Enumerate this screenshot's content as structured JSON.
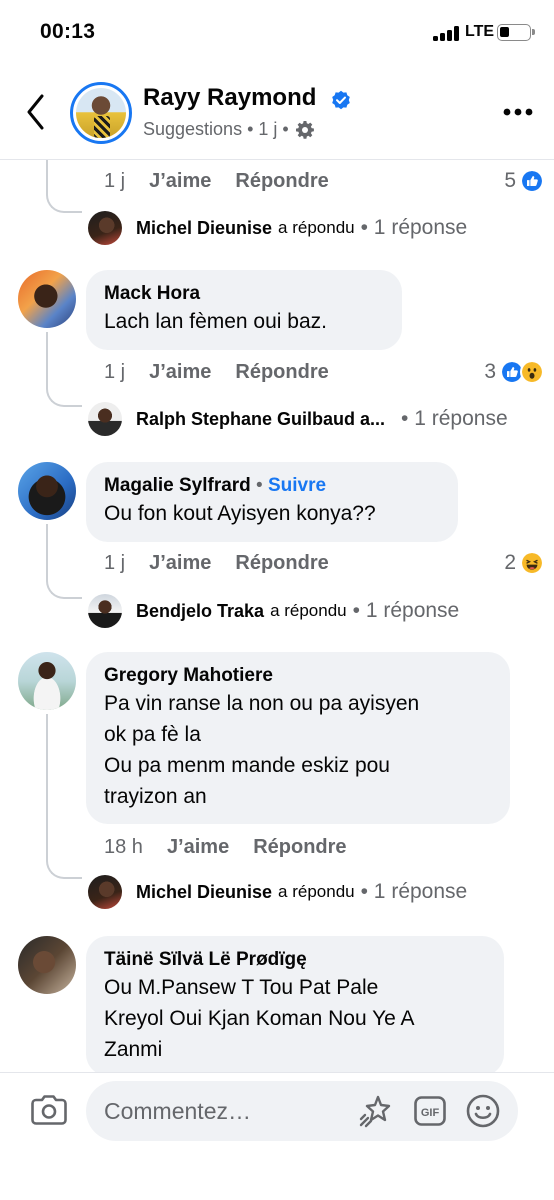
{
  "status_bar": {
    "time": "00:13",
    "network": "LTE"
  },
  "header": {
    "name": "Rayy Raymond",
    "subtitle": "Suggestions • 1 j •",
    "accent_color": "#1877f2"
  },
  "comments": [
    {
      "id": "top-fragment",
      "time": "1 j",
      "like": "J’aime",
      "reply": "Répondre",
      "reaction_count": "5",
      "reactions": [
        "like"
      ],
      "reply_preview": {
        "name": "Michel Dieunise",
        "text": "a répondu",
        "count": "• 1 réponse"
      }
    },
    {
      "id": "mack",
      "author": "Mack Hora",
      "follow": "",
      "text": [
        "Lach lan fèmen oui baz."
      ],
      "time": "1 j",
      "like": "J’aime",
      "reply": "Répondre",
      "reaction_count": "3",
      "reactions": [
        "like",
        "wow"
      ],
      "reply_preview": {
        "name": "Ralph Stephane Guilbaud a...",
        "text": "",
        "count": "• 1 réponse"
      }
    },
    {
      "id": "magalie",
      "author": "Magalie Sylfrard",
      "sep": " • ",
      "follow": "Suivre",
      "text": [
        "Ou fon kout Ayisyen konya??"
      ],
      "time": "1 j",
      "like": "J’aime",
      "reply": "Répondre",
      "reaction_count": "2",
      "reactions": [
        "haha"
      ],
      "reply_preview": {
        "name": "Bendjelo Traka",
        "text": "a répondu",
        "count": "• 1 réponse"
      }
    },
    {
      "id": "gregory",
      "author": "Gregory Mahotiere",
      "follow": "",
      "text": [
        "Pa vin ranse la non ou pa ayisyen",
        "ok pa fè la",
        "Ou pa menm mande eskiz pou",
        "trayizon an"
      ],
      "time": "18 h",
      "like": "J’aime",
      "reply": "Répondre",
      "reply_preview": {
        "name": "Michel Dieunise",
        "text": "a répondu",
        "count": "• 1 réponse"
      }
    },
    {
      "id": "taine",
      "author": "Täinë Sïlvä Lë Prødïgę",
      "text": [
        "Ou M.Pansew T Tou Pat Pale",
        "Kreyol Oui Kjan Koman Nou Ye A",
        "Zanmi"
      ]
    }
  ],
  "composer": {
    "placeholder": "Commentez…"
  },
  "colors": {
    "like_blue": "#1877f2",
    "reaction_yellow": "#f7b928",
    "bubble_bg": "#f0f2f5",
    "meta_gray": "#65676b"
  }
}
